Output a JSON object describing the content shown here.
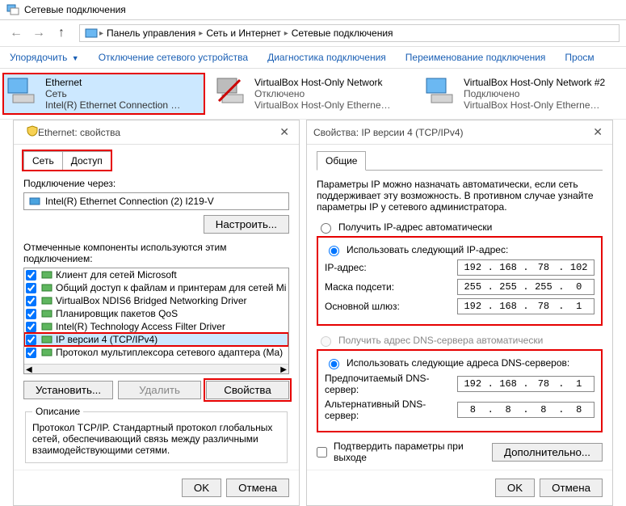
{
  "window_title": "Сетевые подключения",
  "breadcrumb": {
    "root": "Панель управления",
    "mid": "Сеть и Интернет",
    "leaf": "Сетевые подключения"
  },
  "cmdbar": {
    "organize": "Упорядочить",
    "disable": "Отключение сетевого устройства",
    "diagnose": "Диагностика подключения",
    "rename": "Переименование подключения",
    "view": "Просм"
  },
  "adapters": [
    {
      "name": "Ethernet",
      "status": "Сеть",
      "detail": "Intel(R) Ethernet Connection (2) I...",
      "selected": true
    },
    {
      "name": "VirtualBox Host-Only Network",
      "status": "Отключено",
      "detail": "VirtualBox Host-Only Ethernet Ad..."
    },
    {
      "name": "VirtualBox Host-Only Network #2",
      "status": "Подключено",
      "detail": "VirtualBox Host-Only Ethernet Ad..."
    }
  ],
  "dlg_props": {
    "title": "Ethernet: свойства",
    "tabs": {
      "network": "Сеть",
      "access": "Доступ"
    },
    "connect_using": "Подключение через:",
    "adapter_name": "Intel(R) Ethernet Connection (2) I219-V",
    "configure": "Настроить...",
    "components_label": "Отмеченные компоненты используются этим подключением:",
    "components": [
      "Клиент для сетей Microsoft",
      "Общий доступ к файлам и принтерам для сетей Mi",
      "VirtualBox NDIS6 Bridged Networking Driver",
      "Планировщик пакетов QoS",
      "Intel(R) Technology Access Filter Driver",
      "IP версии 4 (TCP/IPv4)",
      "Протокол мультиплексора сетевого адаптера (Ma)"
    ],
    "install": "Установить...",
    "uninstall": "Удалить",
    "properties": "Свойства",
    "desc_title": "Описание",
    "desc_text": "Протокол TCP/IP. Стандартный протокол глобальных сетей, обеспечивающий связь между различными взаимодействующими сетями.",
    "ok": "OK",
    "cancel": "Отмена"
  },
  "dlg_ip": {
    "title": "Свойства: IP версии 4 (TCP/IPv4)",
    "tab": "Общие",
    "intro": "Параметры IP можно назначать автоматически, если сеть поддерживает эту возможность. В противном случае узнайте параметры IP у сетевого администратора.",
    "auto_ip": "Получить IP-адрес автоматически",
    "manual_ip": "Использовать следующий IP-адрес:",
    "ip_label": "IP-адрес:",
    "ip_value": [
      "192",
      "168",
      "78",
      "102"
    ],
    "mask_label": "Маска подсети:",
    "mask_value": [
      "255",
      "255",
      "255",
      "0"
    ],
    "gw_label": "Основной шлюз:",
    "gw_value": [
      "192",
      "168",
      "78",
      "1"
    ],
    "auto_dns": "Получить адрес DNS-сервера автоматически",
    "manual_dns": "Использовать следующие адреса DNS-серверов:",
    "dns1_label": "Предпочитаемый DNS-сервер:",
    "dns1_value": [
      "192",
      "168",
      "78",
      "1"
    ],
    "dns2_label": "Альтернативный DNS-сервер:",
    "dns2_value": [
      "8",
      "8",
      "8",
      "8"
    ],
    "confirm": "Подтвердить параметры при выходе",
    "advanced": "Дополнительно...",
    "ok": "OK",
    "cancel": "Отмена"
  }
}
